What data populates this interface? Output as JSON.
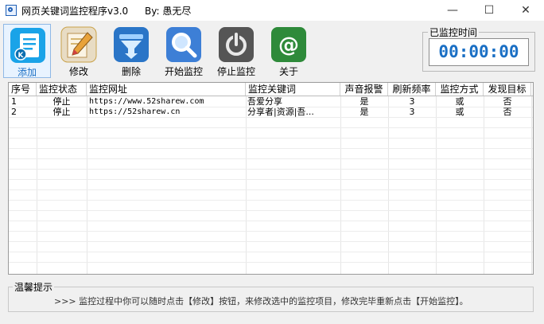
{
  "window": {
    "title": "网页关键词监控程序v3.0",
    "author": "By:  愚无尽",
    "controls": {
      "minimize": "—",
      "maximize": "☐",
      "close": "✕"
    }
  },
  "toolbar": {
    "items": [
      {
        "label": "添加",
        "icon": "add-list-icon",
        "color": "#1aa3e8"
      },
      {
        "label": "修改",
        "icon": "edit-pencil-icon",
        "color": "#c9a24a"
      },
      {
        "label": "删除",
        "icon": "delete-funnel-icon",
        "color": "#2a75c7"
      },
      {
        "label": "开始监控",
        "icon": "search-magnifier-icon",
        "color": "#3d7fd6"
      },
      {
        "label": "停止监控",
        "icon": "power-icon",
        "color": "#555555"
      },
      {
        "label": "关于",
        "icon": "at-sign-icon",
        "color": "#2e8a3a"
      }
    ]
  },
  "timer": {
    "title": "已监控时间",
    "value": "00:00:00",
    "color": "#1a6fc4"
  },
  "table": {
    "columns": [
      "序号",
      "监控状态",
      "监控网址",
      "监控关键词",
      "声音报警",
      "刷新频率",
      "监控方式",
      "发现目标"
    ],
    "rows": [
      [
        "1",
        "停止",
        "https://www.52sharew.com",
        "吾爱分享",
        "是",
        "3",
        "或",
        "否"
      ],
      [
        "2",
        "停止",
        "https://52sharew.cn",
        "分享者|资源|吾...",
        "是",
        "3",
        "或",
        "否"
      ]
    ]
  },
  "tips": {
    "title": "温馨提示",
    "text": ">>> 监控过程中你可以随时点击【修改】按钮，来修改选中的监控项目，修改完毕重新点击【开始监控】。"
  }
}
